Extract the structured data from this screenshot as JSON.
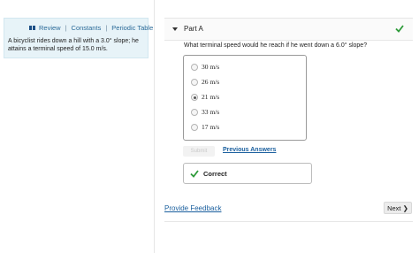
{
  "resources": {
    "review": "Review",
    "constants": "Constants",
    "periodic_table": "Periodic Table",
    "separator": "|"
  },
  "problem": {
    "text": "A bicyclist rides down a hill with a 3.0° slope; he attains a terminal speed of 15.0 m/s."
  },
  "part": {
    "title": "Part A",
    "question": "What terminal speed would he reach if he went down a 6.0° slope?",
    "choices": [
      {
        "label": "30 m/s",
        "selected": false
      },
      {
        "label": "26 m/s",
        "selected": false
      },
      {
        "label": "21 m/s",
        "selected": true
      },
      {
        "label": "33 m/s",
        "selected": false
      },
      {
        "label": "17 m/s",
        "selected": false
      }
    ],
    "submit_label": "Submit",
    "previous_answers_label": "Previous Answers",
    "result_label": "Correct"
  },
  "footer": {
    "feedback_label": "Provide Feedback",
    "next_label": "Next ❯"
  },
  "colors": {
    "link": "#1a5f9e",
    "correct_green": "#2e9b3a",
    "panel_bg": "#e7f3f8"
  }
}
